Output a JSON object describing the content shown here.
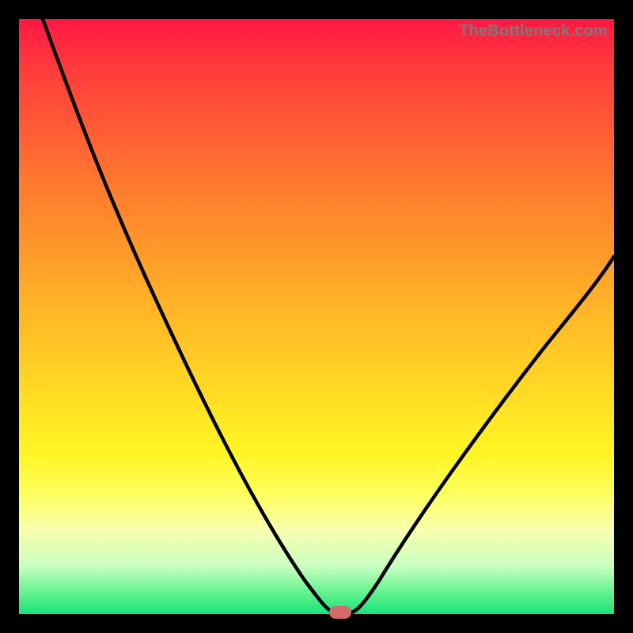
{
  "watermark": "TheBottleneck.com",
  "colors": {
    "frame": "#000000",
    "curve": "#000000",
    "marker": "#d46a6a",
    "gradient_top": "#ff1744",
    "gradient_bottom": "#18e27a"
  },
  "chart_data": {
    "type": "line",
    "title": "",
    "xlabel": "",
    "ylabel": "",
    "xlim": [
      0,
      100
    ],
    "ylim": [
      0,
      100
    ],
    "grid": false,
    "legend": false,
    "annotations": [
      {
        "text": "TheBottleneck.com",
        "position": "top-right"
      }
    ],
    "series": [
      {
        "name": "bottleneck-curve",
        "x": [
          5,
          10,
          15,
          20,
          25,
          30,
          35,
          40,
          45,
          50,
          51,
          52,
          53,
          54,
          55,
          56,
          60,
          65,
          70,
          75,
          80,
          85,
          90,
          95,
          100
        ],
        "values": [
          100,
          92,
          83,
          74,
          64,
          54,
          44,
          34,
          23,
          11,
          5,
          2,
          0,
          0,
          0,
          2,
          8,
          17,
          25,
          32,
          39,
          45,
          51,
          56,
          60
        ]
      }
    ],
    "marker": {
      "x": 54,
      "y": 0
    }
  }
}
